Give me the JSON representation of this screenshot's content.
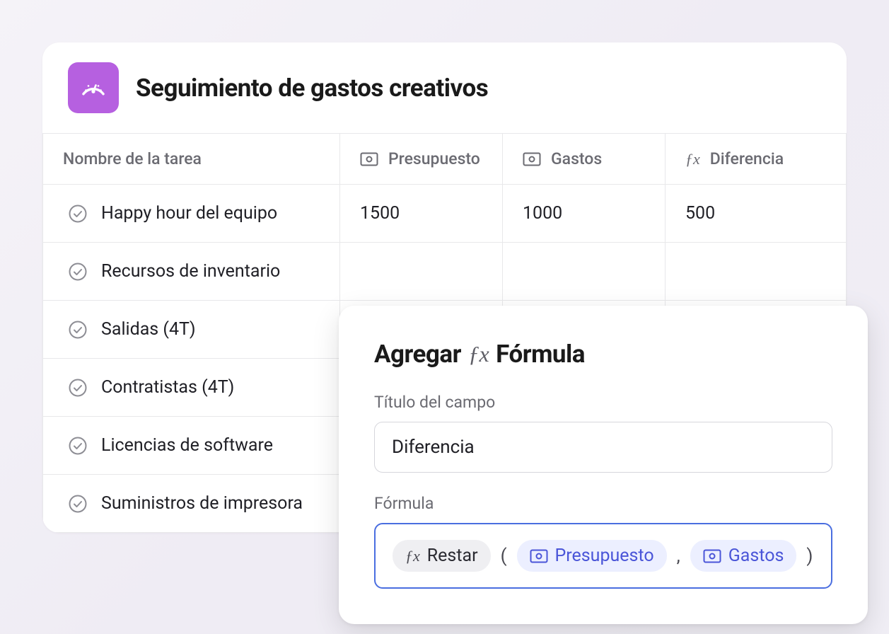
{
  "header": {
    "title": "Seguimiento de gastos creativos",
    "icon": "gauge-icon"
  },
  "table": {
    "columns": {
      "task": "Nombre de la tarea",
      "budget": "Presupuesto",
      "spent": "Gastos",
      "diff": "Diferencia"
    },
    "rows": [
      {
        "task": "Happy hour del equipo",
        "budget": "1500",
        "spent": "1000",
        "diff": "500"
      },
      {
        "task": "Recursos de inventario",
        "budget": "",
        "spent": "",
        "diff": ""
      },
      {
        "task": "Salidas (4T)",
        "budget": "",
        "spent": "",
        "diff": ""
      },
      {
        "task": "Contratistas (4T)",
        "budget": "",
        "spent": "",
        "diff": ""
      },
      {
        "task": "Licencias de software",
        "budget": "",
        "spent": "",
        "diff": ""
      },
      {
        "task": "Suministros de impresora",
        "budget": "",
        "spent": "",
        "diff": ""
      }
    ]
  },
  "panel": {
    "title_prefix": "Agregar",
    "title_suffix": "Fórmula",
    "field_title_label": "Título del campo",
    "field_title_value": "Diferencia",
    "formula_label": "Fórmula",
    "formula": {
      "function": "Restar",
      "open": "(",
      "arg1": "Presupuesto",
      "sep": ",",
      "arg2": "Gastos",
      "close": ")"
    }
  }
}
